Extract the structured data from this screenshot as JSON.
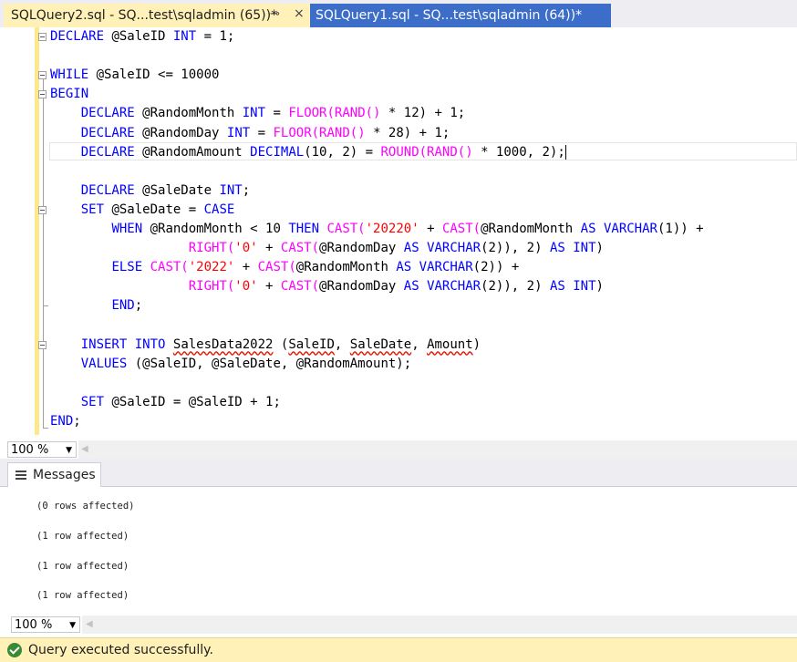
{
  "tabs": [
    {
      "label": "SQLQuery2.sql - SQ...test\\sqladmin (65))*",
      "pin": "⊸",
      "close": "×"
    },
    {
      "label": "SQLQuery1.sql - SQ...test\\sqladmin (64))*"
    }
  ],
  "editor": {
    "lines": [
      [
        "DECLARE",
        " @SaleID ",
        "INT",
        " = 1;"
      ],
      [],
      [
        "WHILE",
        " @SaleID <= 10000"
      ],
      [
        "BEGIN"
      ],
      [
        "    ",
        "DECLARE",
        " @RandomMonth ",
        "INT",
        " = ",
        "FLOOR(RAND()",
        " * 12) + 1;"
      ],
      [
        "    ",
        "DECLARE",
        " @RandomDay ",
        "INT",
        " = ",
        "FLOOR(RAND()",
        " * 28) + 1;"
      ],
      [
        "    ",
        "DECLARE",
        " @RandomAmount ",
        "DECIMAL",
        "(10, 2) = ",
        "ROUND(RAND()",
        " * 1000, 2);"
      ],
      [],
      [
        "    ",
        "DECLARE",
        " @SaleDate ",
        "INT",
        ";"
      ],
      [
        "    ",
        "SET",
        " @SaleDate = ",
        "CASE"
      ],
      [
        "        ",
        "WHEN",
        " @RandomMonth < 10 ",
        "THEN",
        " ",
        "CAST(",
        "'20220'",
        " + ",
        "CAST(",
        "@RandomMonth ",
        "AS",
        " ",
        "VARCHAR",
        "(1)) +"
      ],
      [
        "                  ",
        "RIGHT(",
        "'0'",
        " + ",
        "CAST(",
        "@RandomDay ",
        "AS",
        " ",
        "VARCHAR",
        "(2)), 2) ",
        "AS",
        " ",
        "INT",
        ")"
      ],
      [
        "        ",
        "ELSE",
        " ",
        "CAST(",
        "'2022'",
        " + ",
        "CAST(",
        "@RandomMonth ",
        "AS",
        " ",
        "VARCHAR",
        "(2)) +"
      ],
      [
        "                  ",
        "RIGHT(",
        "'0'",
        " + ",
        "CAST(",
        "@RandomDay ",
        "AS",
        " ",
        "VARCHAR",
        "(2)), 2) ",
        "AS",
        " ",
        "INT",
        ")"
      ],
      [
        "        ",
        "END",
        ";"
      ],
      [],
      [
        "    ",
        "INSERT",
        " ",
        "INTO",
        " ",
        "SalesData2022",
        " (",
        "SaleID",
        ", ",
        "SaleDate",
        ", ",
        "Amount",
        ")"
      ],
      [
        "    ",
        "VALUES",
        " (@SaleID, @SaleDate, @RandomAmount);"
      ],
      [],
      [
        "    ",
        "SET",
        " @SaleID = @SaleID + 1;"
      ],
      [
        "END",
        ";"
      ]
    ]
  },
  "editor_zoom": {
    "value": "100 %"
  },
  "results": {
    "tab_label": "Messages",
    "messages": [
      "(0 rows affected)",
      "(1 row affected)",
      "(1 row affected)",
      "(1 row affected)"
    ]
  },
  "results_zoom": {
    "value": "100 %"
  },
  "status": {
    "text": "Query executed successfully.",
    "color": "#388a34"
  },
  "colors": {
    "keyword": "#0000ff",
    "function": "#ff00ff",
    "string": "#ff0000",
    "tab_active": "#fff1b8",
    "tab_inactive": "#3c6ec9"
  }
}
